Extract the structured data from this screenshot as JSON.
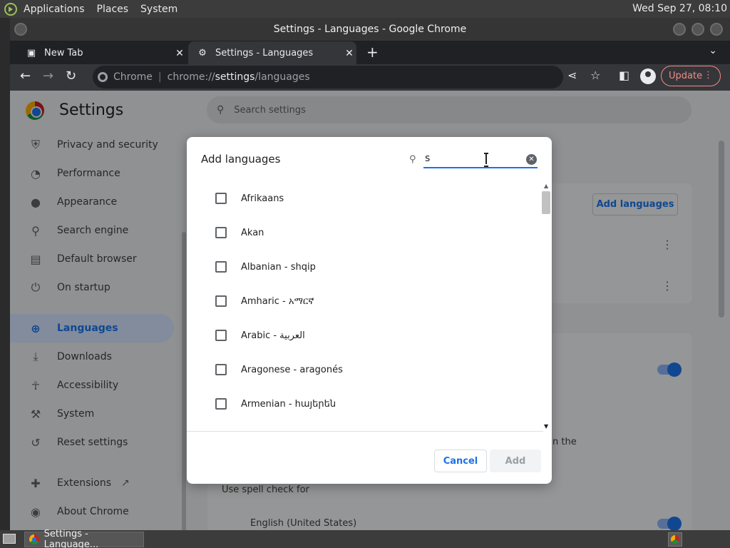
{
  "system_panel": {
    "menus": [
      "Applications",
      "Places",
      "System"
    ],
    "clock": "Wed Sep 27, 08:10"
  },
  "window": {
    "title": "Settings - Languages - Google Chrome"
  },
  "tabs": [
    {
      "label": "New Tab",
      "close": "✕",
      "icon": "new-tab-icon"
    },
    {
      "label": "Settings - Languages",
      "close": "✕",
      "icon": "gear-icon"
    }
  ],
  "toolbar": {
    "new_tab": "+",
    "omnibox": {
      "site": "Chrome",
      "url_prefix": "chrome://",
      "url_host": "settings",
      "url_path": "/languages"
    },
    "update_label": "Update"
  },
  "settings": {
    "title": "Settings",
    "search_placeholder": "Search settings",
    "sidebar": [
      {
        "label": "Privacy and security",
        "icon": "shield-icon",
        "glyph": "⛨"
      },
      {
        "label": "Performance",
        "icon": "speedometer-icon",
        "glyph": "◔"
      },
      {
        "label": "Appearance",
        "icon": "palette-icon",
        "glyph": "●"
      },
      {
        "label": "Search engine",
        "icon": "search-icon",
        "glyph": "⚲"
      },
      {
        "label": "Default browser",
        "icon": "browser-icon",
        "glyph": "▤"
      },
      {
        "label": "On startup",
        "icon": "power-icon",
        "glyph": "⏻"
      },
      {
        "label": "Languages",
        "icon": "globe-icon",
        "glyph": "⊕",
        "selected": true
      },
      {
        "label": "Downloads",
        "icon": "download-icon",
        "glyph": "⤓"
      },
      {
        "label": "Accessibility",
        "icon": "accessibility-icon",
        "glyph": "☥"
      },
      {
        "label": "System",
        "icon": "wrench-icon",
        "glyph": "⚒"
      },
      {
        "label": "Reset settings",
        "icon": "history-icon",
        "glyph": "↺"
      },
      {
        "label": "Extensions",
        "icon": "puzzle-icon",
        "glyph": "✚"
      },
      {
        "label": "About Chrome",
        "icon": "chrome-icon",
        "glyph": "◉"
      }
    ],
    "add_languages_button": "Add languages",
    "spell_check_for": "Use spell check for",
    "spell_language": "English (United States)",
    "partial_text": "n the"
  },
  "dialog": {
    "title": "Add languages",
    "search_value": "s",
    "languages": [
      "Afrikaans",
      "Akan",
      "Albanian - shqip",
      "Amharic - አማርኛ",
      "Arabic - العربية",
      "Aragonese - aragonés",
      "Armenian - հայերեն"
    ],
    "cancel_label": "Cancel",
    "add_label": "Add"
  },
  "taskbar": {
    "task_label": "Settings - Language..."
  }
}
